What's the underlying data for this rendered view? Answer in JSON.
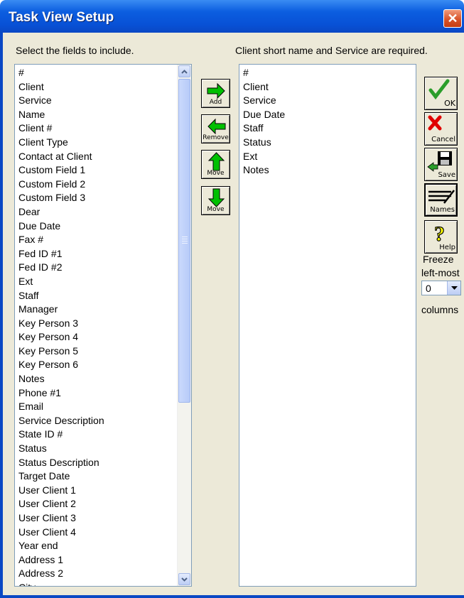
{
  "window": {
    "title": "Task View Setup",
    "close_glyph": "✕"
  },
  "labels": {
    "select_fields": "Select the fields to include.",
    "required": "Client short name and Service are required.",
    "freeze_1": "Freeze",
    "freeze_2": "left-most",
    "columns": "columns"
  },
  "available_fields": [
    "#",
    "Client",
    "Service",
    "Name",
    "Client #",
    "Client Type",
    "Contact at Client",
    "Custom Field 1",
    "Custom Field 2",
    "Custom Field 3",
    "Dear",
    "Due Date",
    "Fax #",
    "Fed ID #1",
    "Fed ID #2",
    "Ext",
    "Staff",
    "Manager",
    "Key Person 3",
    "Key Person 4",
    "Key Person 5",
    "Key Person 6",
    "Notes",
    "Phone #1",
    "Email",
    "Service Description",
    "State ID #",
    "Status",
    "Status Description",
    "Target Date",
    "User Client 1",
    "User Client 2",
    "User Client 3",
    "User Client 4",
    "Year end",
    "Address 1",
    "Address 2",
    "City"
  ],
  "selected_fields": [
    "#",
    "Client",
    "Service",
    "Due Date",
    "Staff",
    "Status",
    "Ext",
    "Notes"
  ],
  "buttons": {
    "add": "Add",
    "remove": "Remove",
    "move_up": "Move",
    "move_down": "Move",
    "ok": "OK",
    "cancel": "Cancel",
    "save": "Save",
    "names": "Names",
    "help": "Help"
  },
  "freeze_value": "0",
  "colors": {
    "title_bar": "#0851d6",
    "dialog_bg": "#ece9d8",
    "arrow_green": "#00c000",
    "check_green": "#2a9d2a",
    "cancel_red": "#e00000",
    "help_yellow": "#ffff00"
  }
}
